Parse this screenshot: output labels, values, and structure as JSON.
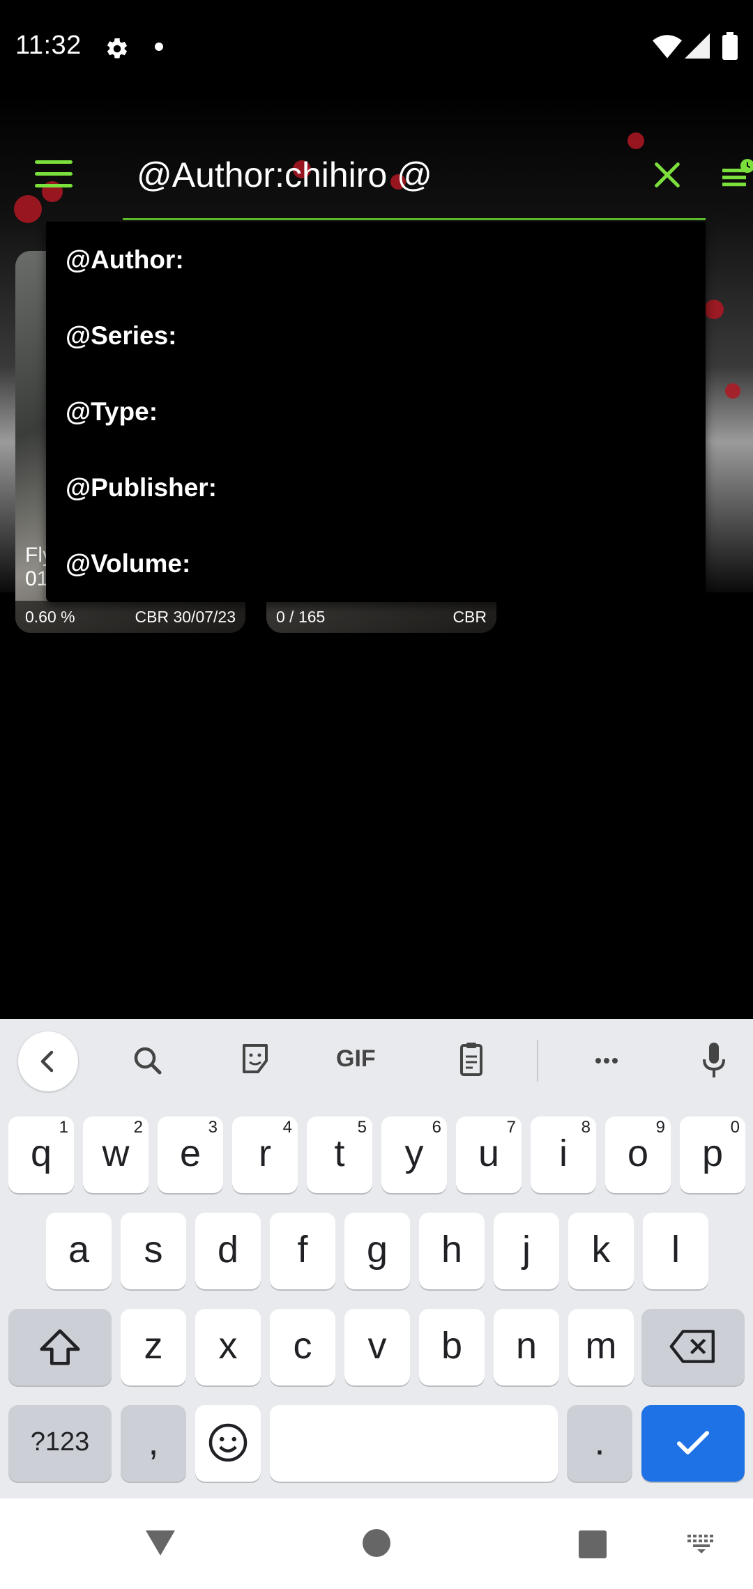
{
  "status_bar": {
    "time": "11:32"
  },
  "search": {
    "query": "@Author:chihiro @"
  },
  "cards": [
    {
      "title_line1": "Fly",
      "title_line2": "01",
      "progress": "0.60 %",
      "info": "CBR 30/07/23"
    },
    {
      "progress": "0 / 165",
      "info": "CBR"
    }
  ],
  "dropdown": {
    "items": [
      "@Author:",
      "@Series:",
      "@Type:",
      "@Publisher:",
      "@Volume:"
    ]
  },
  "keyboard": {
    "row1": [
      {
        "k": "q",
        "h": "1"
      },
      {
        "k": "w",
        "h": "2"
      },
      {
        "k": "e",
        "h": "3"
      },
      {
        "k": "r",
        "h": "4"
      },
      {
        "k": "t",
        "h": "5"
      },
      {
        "k": "y",
        "h": "6"
      },
      {
        "k": "u",
        "h": "7"
      },
      {
        "k": "i",
        "h": "8"
      },
      {
        "k": "o",
        "h": "9"
      },
      {
        "k": "p",
        "h": "0"
      }
    ],
    "row2": [
      "a",
      "s",
      "d",
      "f",
      "g",
      "h",
      "j",
      "k",
      "l"
    ],
    "row3": [
      "z",
      "x",
      "c",
      "v",
      "b",
      "n",
      "m"
    ],
    "symbols_label": "?123",
    "comma": ",",
    "period": ".",
    "gif_label": "GIF"
  },
  "colors": {
    "accent": "#7be03c",
    "key_blue": "#1f72e6"
  }
}
